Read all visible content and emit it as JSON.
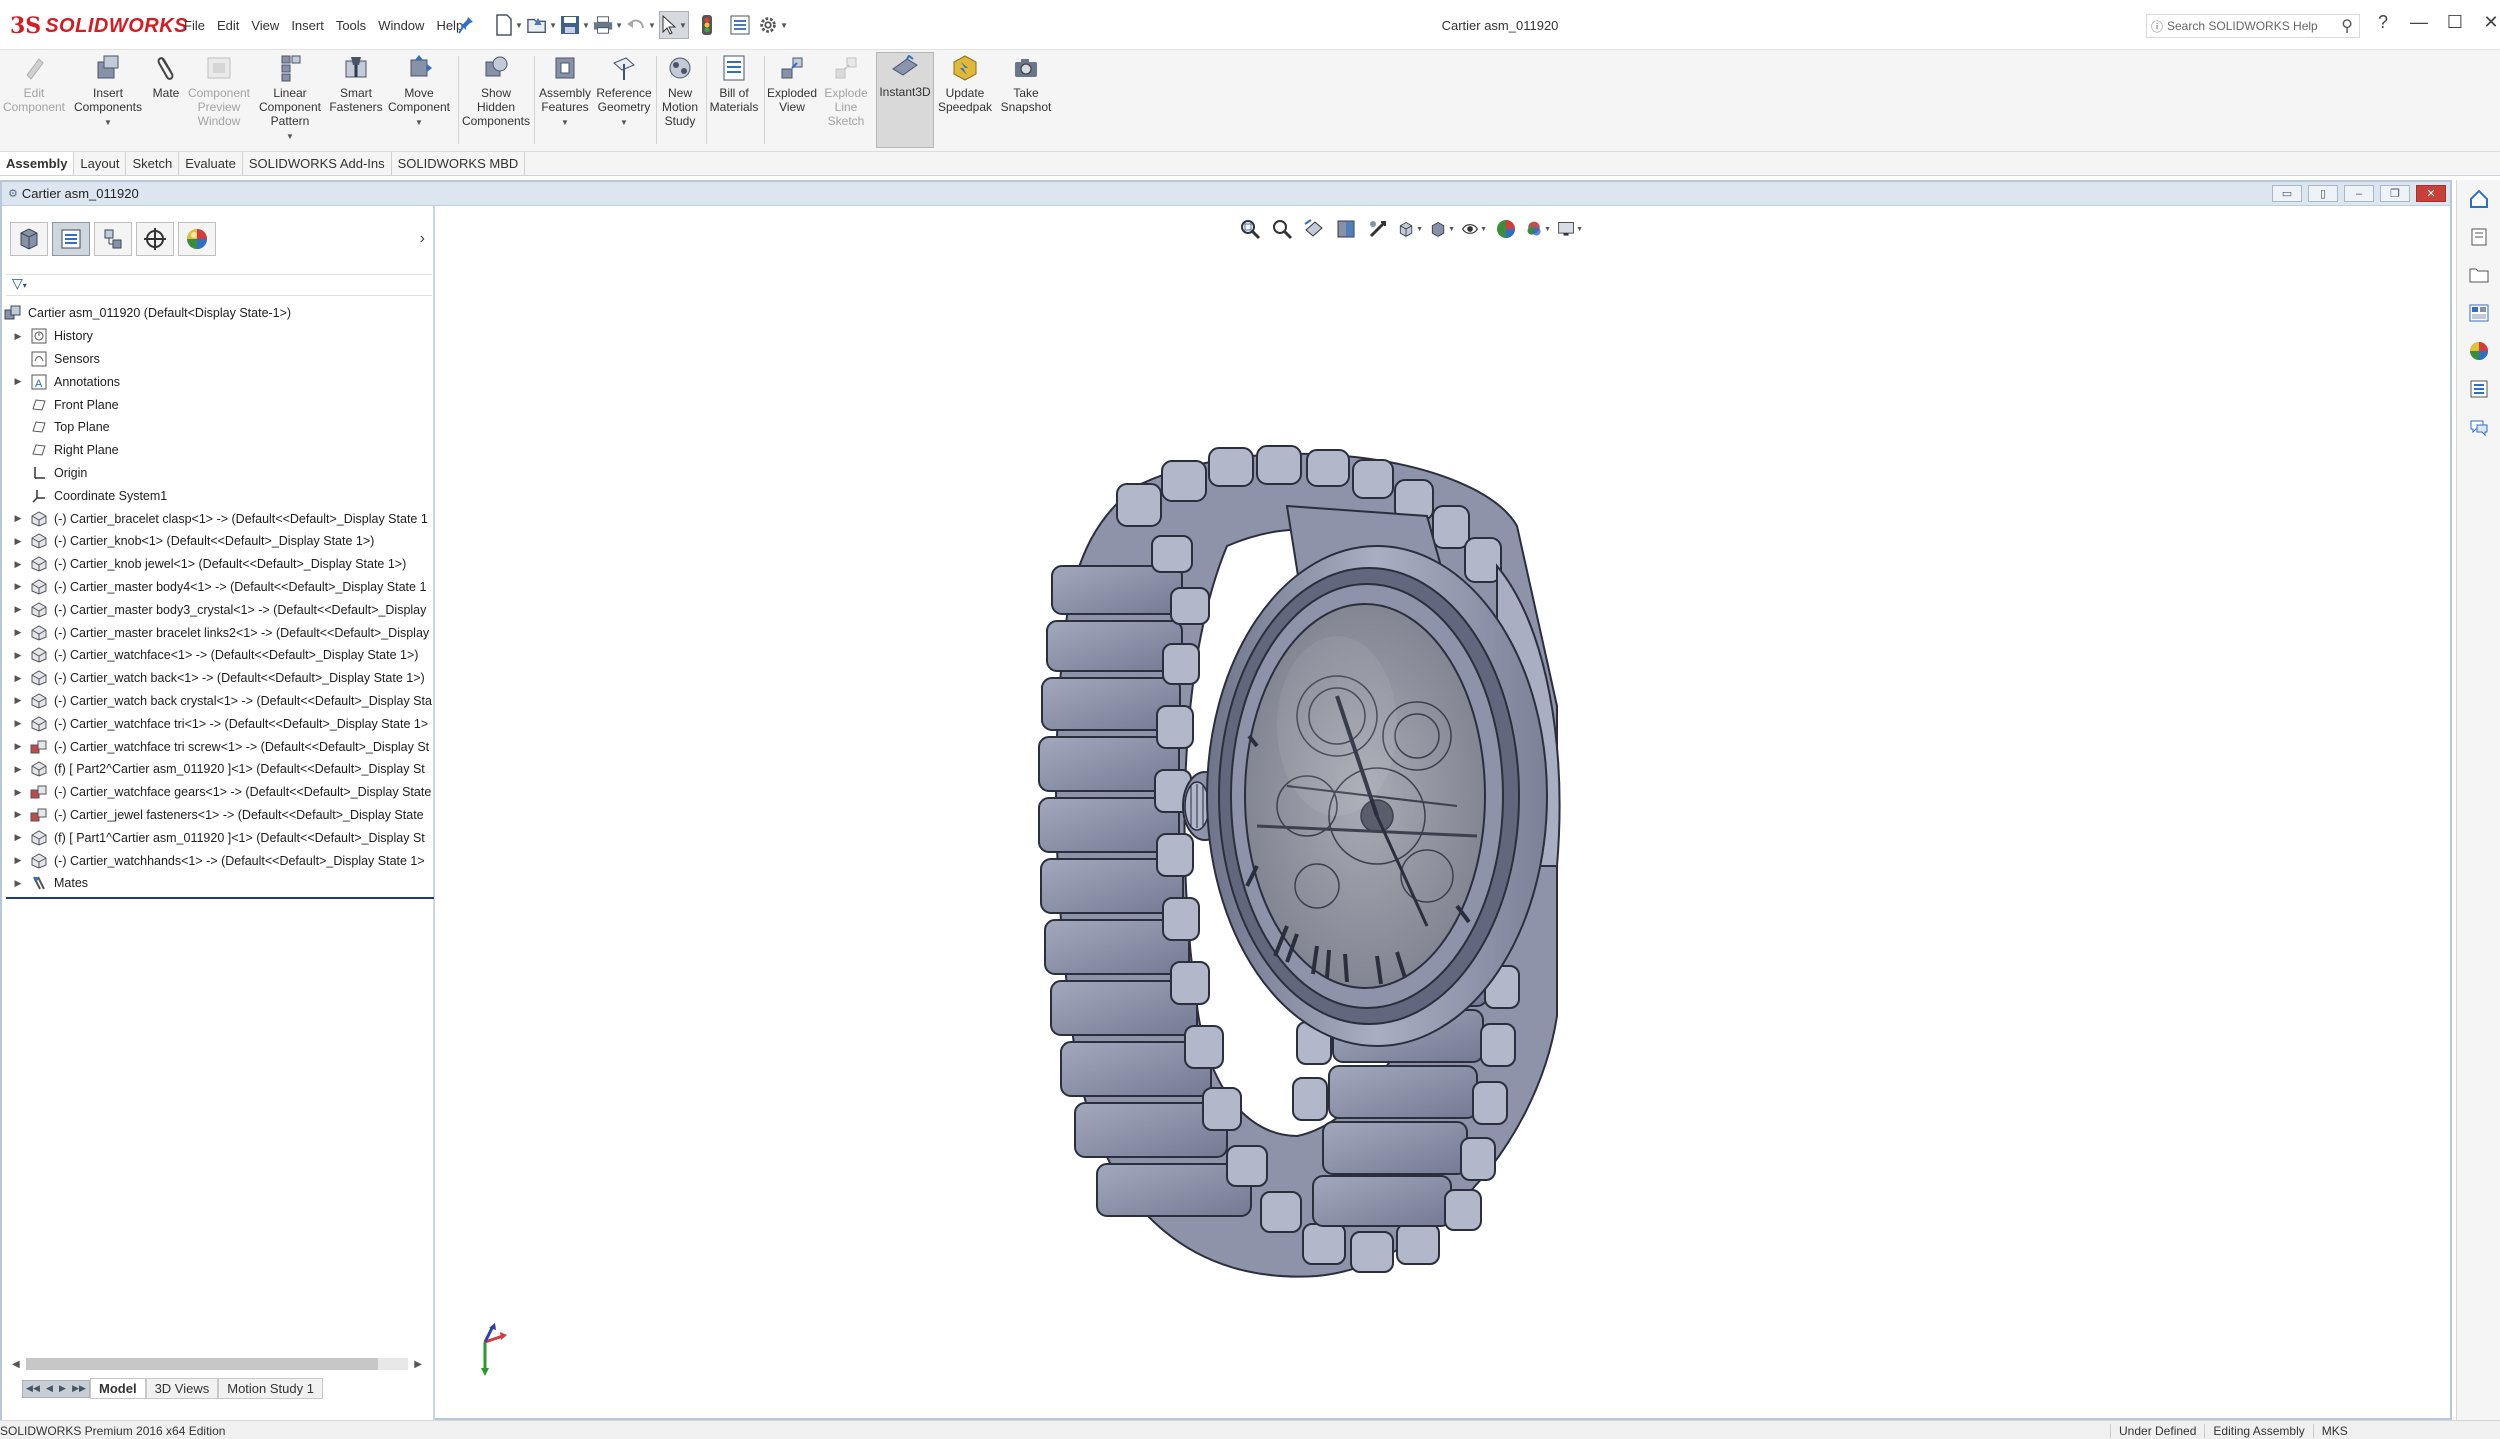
{
  "app": {
    "logo_ds": "3S",
    "logo_text": "SOLIDWORKS",
    "document_title": "Cartier asm_011920",
    "help_search_placeholder": "Search SOLIDWORKS Help"
  },
  "menu": [
    "File",
    "Edit",
    "View",
    "Insert",
    "Tools",
    "Window",
    "Help"
  ],
  "commands": [
    {
      "label": "Edit\nComponent",
      "enabled": false
    },
    {
      "label": "Insert\nComponents",
      "enabled": true,
      "dropdown": true
    },
    {
      "label": "Mate",
      "enabled": true
    },
    {
      "label": "Component\nPreview\nWindow",
      "enabled": false
    },
    {
      "label": "Linear\nComponent\nPattern",
      "enabled": true,
      "dropdown": true
    },
    {
      "label": "Smart\nFasteners",
      "enabled": true
    },
    {
      "label": "Move\nComponent",
      "enabled": true,
      "dropdown": true
    },
    {
      "label": "Show\nHidden\nComponents",
      "enabled": true
    },
    {
      "label": "Assembly\nFeatures",
      "enabled": true,
      "dropdown": true
    },
    {
      "label": "Reference\nGeometry",
      "enabled": true,
      "dropdown": true
    },
    {
      "label": "New\nMotion\nStudy",
      "enabled": true
    },
    {
      "label": "Bill of\nMaterials",
      "enabled": true
    },
    {
      "label": "Exploded\nView",
      "enabled": true
    },
    {
      "label": "Explode\nLine\nSketch",
      "enabled": false
    },
    {
      "label": "Instant3D",
      "enabled": true,
      "active": true
    },
    {
      "label": "Update\nSpeedpak",
      "enabled": true
    },
    {
      "label": "Take\nSnapshot",
      "enabled": true
    }
  ],
  "command_tabs": [
    "Assembly",
    "Layout",
    "Sketch",
    "Evaluate",
    "SOLIDWORKS Add-Ins",
    "SOLIDWORKS MBD"
  ],
  "active_command_tab": "Assembly",
  "document_window_title": "Cartier asm_011920",
  "tree": {
    "root": "Cartier asm_011920  (Default<Display State-1>)",
    "items": [
      {
        "label": "History",
        "icon": "history-icon",
        "expandable": true
      },
      {
        "label": "Sensors",
        "icon": "sensor-icon",
        "expandable": false
      },
      {
        "label": "Annotations",
        "icon": "annotation-icon",
        "expandable": true
      },
      {
        "label": "Front Plane",
        "icon": "plane-icon",
        "expandable": false
      },
      {
        "label": "Top Plane",
        "icon": "plane-icon",
        "expandable": false
      },
      {
        "label": "Right Plane",
        "icon": "plane-icon",
        "expandable": false
      },
      {
        "label": "Origin",
        "icon": "origin-icon",
        "expandable": false
      },
      {
        "label": "Coordinate System1",
        "icon": "coordinate-system-icon",
        "expandable": false
      },
      {
        "label": "(-) Cartier_bracelet clasp<1> -> (Default<<Default>_Display State 1",
        "icon": "part-icon",
        "expandable": true
      },
      {
        "label": "(-) Cartier_knob<1> (Default<<Default>_Display State 1>)",
        "icon": "part-icon",
        "expandable": true
      },
      {
        "label": "(-) Cartier_knob jewel<1> (Default<<Default>_Display State 1>)",
        "icon": "part-icon",
        "expandable": true
      },
      {
        "label": "(-) Cartier_master body4<1> -> (Default<<Default>_Display State 1",
        "icon": "part-icon",
        "expandable": true
      },
      {
        "label": "(-) Cartier_master body3_crystal<1> -> (Default<<Default>_Display",
        "icon": "part-icon",
        "expandable": true
      },
      {
        "label": "(-) Cartier_master bracelet links2<1> -> (Default<<Default>_Display",
        "icon": "part-icon",
        "expandable": true
      },
      {
        "label": "(-) Cartier_watchface<1> -> (Default<<Default>_Display State 1>)",
        "icon": "part-icon",
        "expandable": true
      },
      {
        "label": "(-) Cartier_watch back<1> -> (Default<<Default>_Display State 1>)",
        "icon": "part-icon",
        "expandable": true
      },
      {
        "label": "(-) Cartier_watch back crystal<1> -> (Default<<Default>_Display Sta",
        "icon": "part-icon",
        "expandable": true
      },
      {
        "label": "(-) Cartier_watchface tri<1> -> (Default<<Default>_Display State 1>",
        "icon": "part-icon",
        "expandable": true
      },
      {
        "label": "(-) Cartier_watchface tri screw<1> -> (Default<<Default>_Display St",
        "icon": "subassembly-icon",
        "expandable": true
      },
      {
        "label": "(f) [ Part2^Cartier asm_011920 ]<1> (Default<<Default>_Display St",
        "icon": "part-icon",
        "expandable": true
      },
      {
        "label": "(-) Cartier_watchface gears<1> -> (Default<<Default>_Display State",
        "icon": "subassembly-icon",
        "expandable": true
      },
      {
        "label": "(-) Cartier_jewel fasteners<1> -> (Default<<Default>_Display State",
        "icon": "subassembly-icon",
        "expandable": true
      },
      {
        "label": "(f) [ Part1^Cartier asm_011920 ]<1> (Default<<Default>_Display St",
        "icon": "part-icon",
        "expandable": true
      },
      {
        "label": "(-) Cartier_watchhands<1> -> (Default<<Default>_Display State 1>",
        "icon": "part-icon",
        "expandable": true
      },
      {
        "label": "Mates",
        "icon": "mates-icon",
        "expandable": true
      }
    ]
  },
  "bottom_tabs": [
    "Model",
    "3D Views",
    "Motion Study 1"
  ],
  "active_bottom_tab": "Model",
  "status": {
    "edition": "SOLIDWORKS Premium 2016 x64 Edition",
    "definition": "Under Defined",
    "mode": "Editing Assembly",
    "units": "MKS"
  },
  "colors": {
    "model_fill": "#8d92a8",
    "model_edge": "#2b2e3d",
    "brand_red": "#d31c23",
    "window_border": "#b8c8da"
  }
}
